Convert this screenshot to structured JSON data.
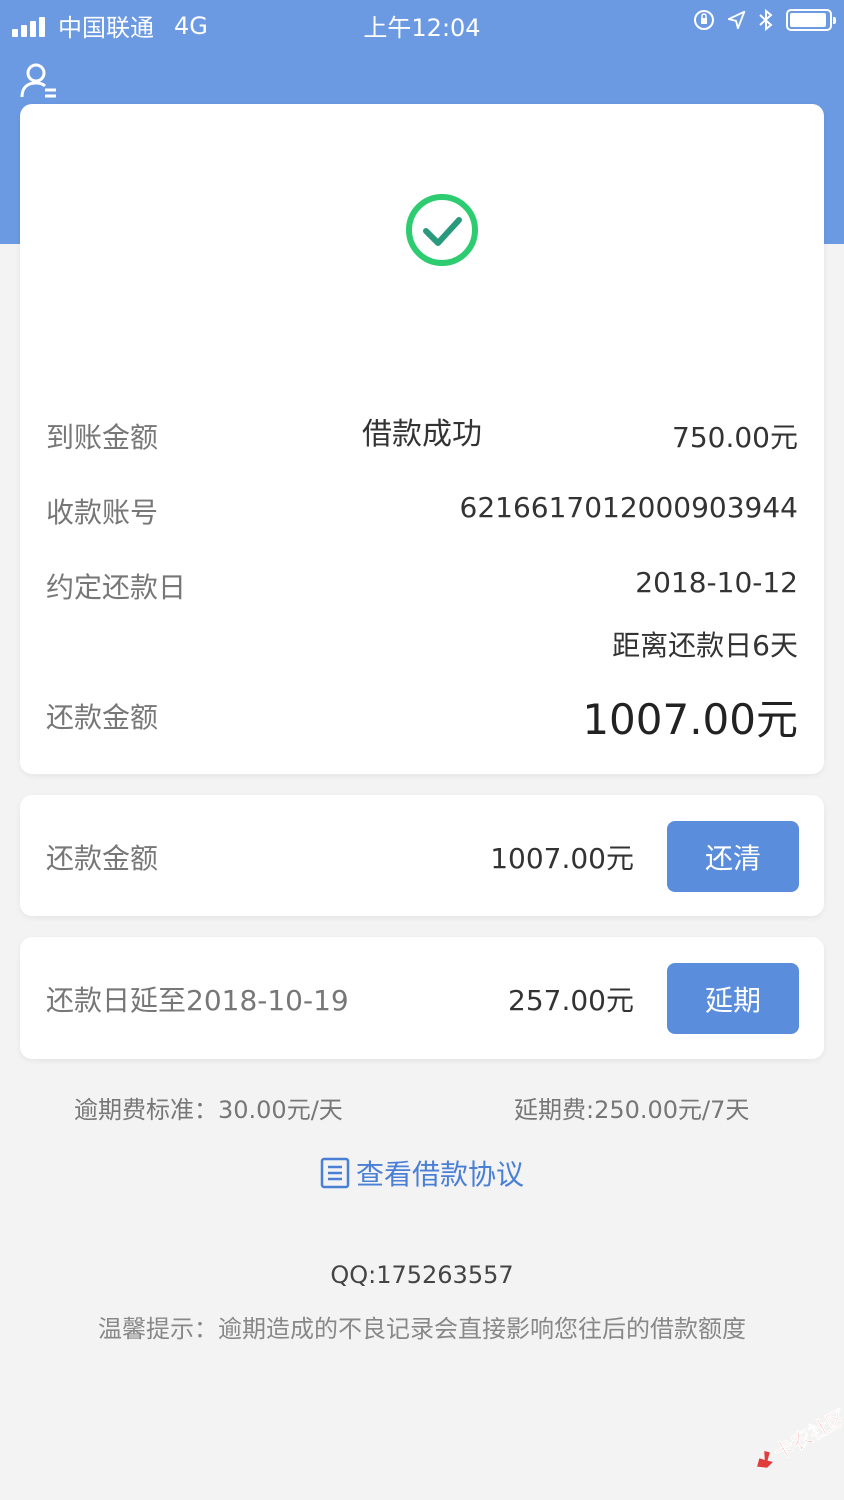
{
  "status_bar": {
    "carrier": "中国联通",
    "network": "4G",
    "time": "上午12:04"
  },
  "success": {
    "title": "借款成功"
  },
  "details": {
    "received_label": "到账金额",
    "received_value": "750.00元",
    "account_label": "收款账号",
    "account_value": "6216617012000903944",
    "due_label": "约定还款日",
    "due_value": "2018-10-12",
    "days_left": "距离还款日6天",
    "repay_label": "还款金额",
    "repay_value": "1007.00元"
  },
  "repay_card": {
    "label": "还款金额",
    "amount": "1007.00元",
    "button": "还清"
  },
  "extend_card": {
    "label": "还款日延至2018-10-19",
    "amount": "257.00元",
    "button": "延期"
  },
  "fees": {
    "overdue": "逾期费标准：30.00元/天",
    "extension": "延期费:250.00元/7天"
  },
  "agreement_link": "查看借款协议",
  "qq": "QQ:175263557",
  "tip": "温馨提示：逾期造成的不良记录会直接影响您往后的借款额度",
  "watermark_text": "卡农社区",
  "colors": {
    "header": "#6b9ae2",
    "button": "#5b8ddd",
    "success": "#2ecc71",
    "link": "#4a7fd6"
  }
}
